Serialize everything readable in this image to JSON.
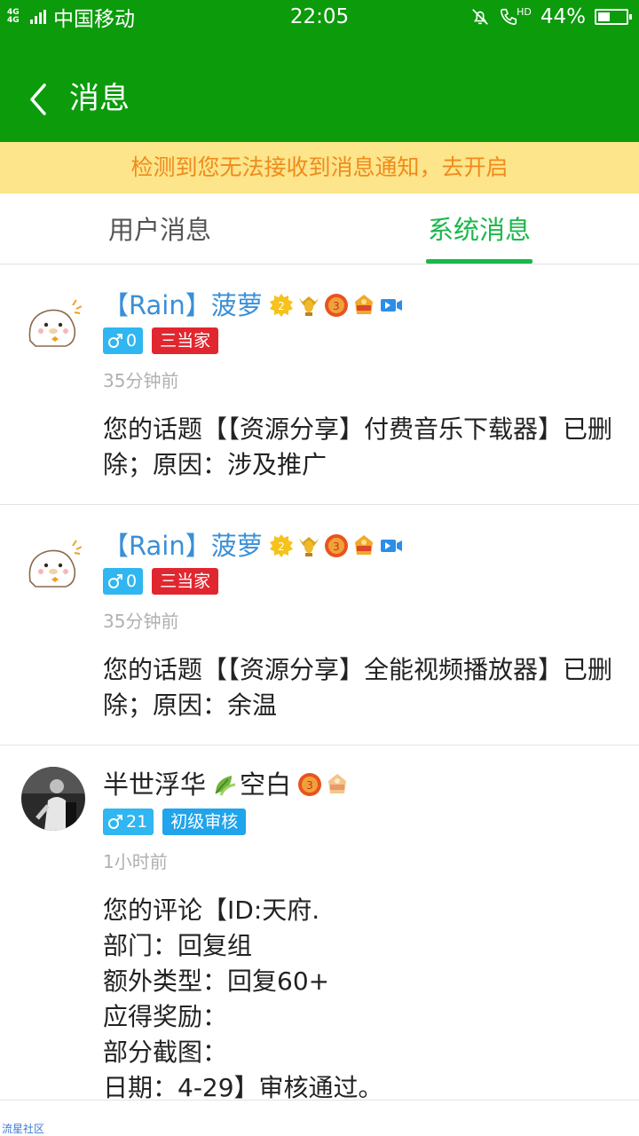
{
  "status_bar": {
    "network_label": "4G 4G",
    "carrier": "中国移动",
    "time": "22:05",
    "battery_percent": "44%",
    "battery_level": 0.44,
    "call_label": "HD"
  },
  "header": {
    "title": "消息"
  },
  "notice": {
    "text": "检测到您无法接收到消息通知，去开启"
  },
  "tabs": [
    {
      "label": "用户消息",
      "active": false
    },
    {
      "label": "系统消息",
      "active": true
    }
  ],
  "colors": {
    "header_green": "#0b9b0b",
    "tab_active": "#1ab84a",
    "notice_bg": "#fce58a",
    "notice_text": "#f08a1c",
    "name_blue": "#3a8fd8",
    "badge_red": "#e0272f",
    "badge_blue": "#20a4ec"
  },
  "messages": [
    {
      "avatar": "seal-cartoon-avatar",
      "name": "【Rain】菠萝",
      "badges": [
        "level-2-icon",
        "trophy-icon",
        "medal-3-icon",
        "honor-badge-icon",
        "video-icon"
      ],
      "gender_count": "0",
      "title": "三当家",
      "time": "35分钟前",
      "text": "您的话题【【资源分享】付费音乐下载器】已删除；原因：涉及推广"
    },
    {
      "avatar": "seal-cartoon-avatar",
      "name": "【Rain】菠萝",
      "badges": [
        "level-2-icon",
        "trophy-icon",
        "medal-3-icon",
        "honor-badge-icon",
        "video-icon"
      ],
      "gender_count": "0",
      "title": "三当家",
      "time": "35分钟前",
      "text": "您的话题【【资源分享】全能视频播放器】已删除；原因：余温"
    },
    {
      "avatar": "photo-avatar",
      "name": "半世浮华",
      "name_suffix": "空白",
      "badges": [
        "leaf-icon",
        "medal-3-icon",
        "honor-badge-icon"
      ],
      "gender_count": "21",
      "title": "初级审核",
      "time": "1小时前",
      "text": "您的评论【ID:天府.\n部门：回复组\n额外类型：回复60+\n应得奖励：\n部分截图：\n日期：4-29】审核通过。"
    }
  ],
  "watermark": "流星社区"
}
